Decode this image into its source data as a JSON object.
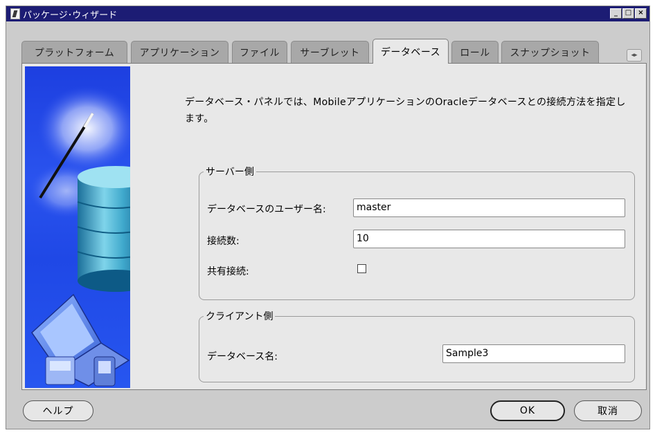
{
  "window": {
    "title": "パッケージ･ウィザード",
    "controls": {
      "minimize": "_",
      "maximize": "□",
      "close": "×"
    }
  },
  "tabs": [
    {
      "label": "プラットフォーム",
      "active": false
    },
    {
      "label": "アプリケーション",
      "active": false
    },
    {
      "label": "ファイル",
      "active": false
    },
    {
      "label": "サーブレット",
      "active": false
    },
    {
      "label": "データベース",
      "active": true
    },
    {
      "label": "ロール",
      "active": false
    },
    {
      "label": "スナップショット",
      "active": false
    }
  ],
  "tab_scroll_icon": "◂▸",
  "description": "データベース・パネルでは、MobileアプリケーションのOracleデータベースとの接続方法を指定します。",
  "server_side": {
    "legend": "サーバー側",
    "db_user_label": "データベースのユーザー名:",
    "db_user_value": "master",
    "connections_label": "接続数:",
    "connections_value": "10",
    "shared_label": "共有接続:",
    "shared_checked": false
  },
  "client_side": {
    "legend": "クライアント側",
    "db_name_label": "データベース名:",
    "db_name_value": "Sample3"
  },
  "buttons": {
    "help": "ヘルプ",
    "ok": "OK",
    "cancel": "取消"
  },
  "colors": {
    "titlebar": "#1c1c74",
    "sidebar_blue": "#2a53ee",
    "dialog_bg": "#cccccc",
    "panel_bg": "#e8e8e8"
  }
}
